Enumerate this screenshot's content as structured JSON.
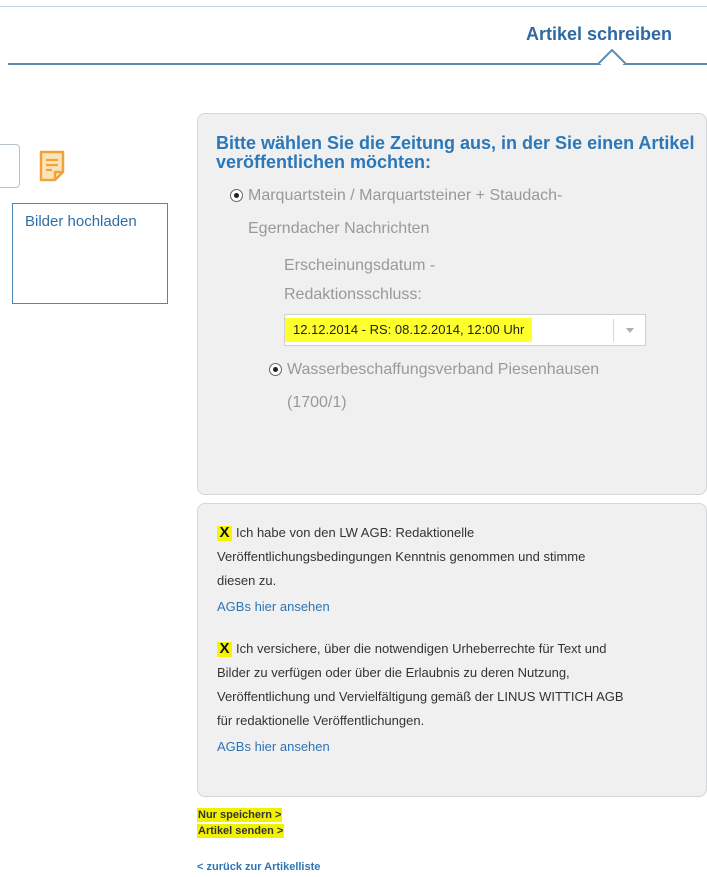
{
  "header": {
    "title": "Artikel schreiben"
  },
  "left": {
    "note_icon": "note-icon",
    "upload_label": "Bilder hochladen"
  },
  "newspaper": {
    "heading": "Bitte wählen Sie die Zeitung aus, in der Sie einen Artikel veröffentlichen möchten:",
    "option_1": {
      "line_1": "Marquartstein / Marquartsteiner + Staudach-",
      "line_2": "Egerndacher Nachrichten",
      "selected": true
    },
    "date_label": {
      "line_1": "Erscheinungsdatum -",
      "line_2": "Redaktionsschluss:"
    },
    "date_select": {
      "value": "12.12.2014 - RS: 08.12.2014, 12:00 Uhr"
    },
    "option_2": {
      "line_1": "Wasserbeschaffungsverband Piesenhausen",
      "line_2": "(1700/1)",
      "selected": true
    }
  },
  "terms": {
    "check_mark": "X",
    "highlight_color": "#f5f500",
    "item_1": {
      "line_1": "Ich habe von den LW AGB: Redaktionelle",
      "line_2": "Veröffentlichungsbedingungen Kenntnis genommen und stimme",
      "line_3": "diesen zu.",
      "link": "AGBs hier ansehen"
    },
    "item_2": {
      "line_1": "Ich versichere, über die notwendigen Urheberrechte für Text und",
      "line_2": "Bilder zu verfügen oder über die Erlaubnis zu deren Nutzung,",
      "line_3": "Veröffentlichung und Vervielfältigung gemäß der LINUS WITTICH AGB",
      "line_4": "für redaktionelle Veröffentlichungen.",
      "link": "AGBs hier ansehen"
    }
  },
  "actions": {
    "save": "Nur speichern >",
    "send": "Artikel senden >",
    "back": "< zurück zur Artikelliste"
  },
  "colors": {
    "accent": "#2b77b8",
    "highlight": "#ffff2b"
  }
}
